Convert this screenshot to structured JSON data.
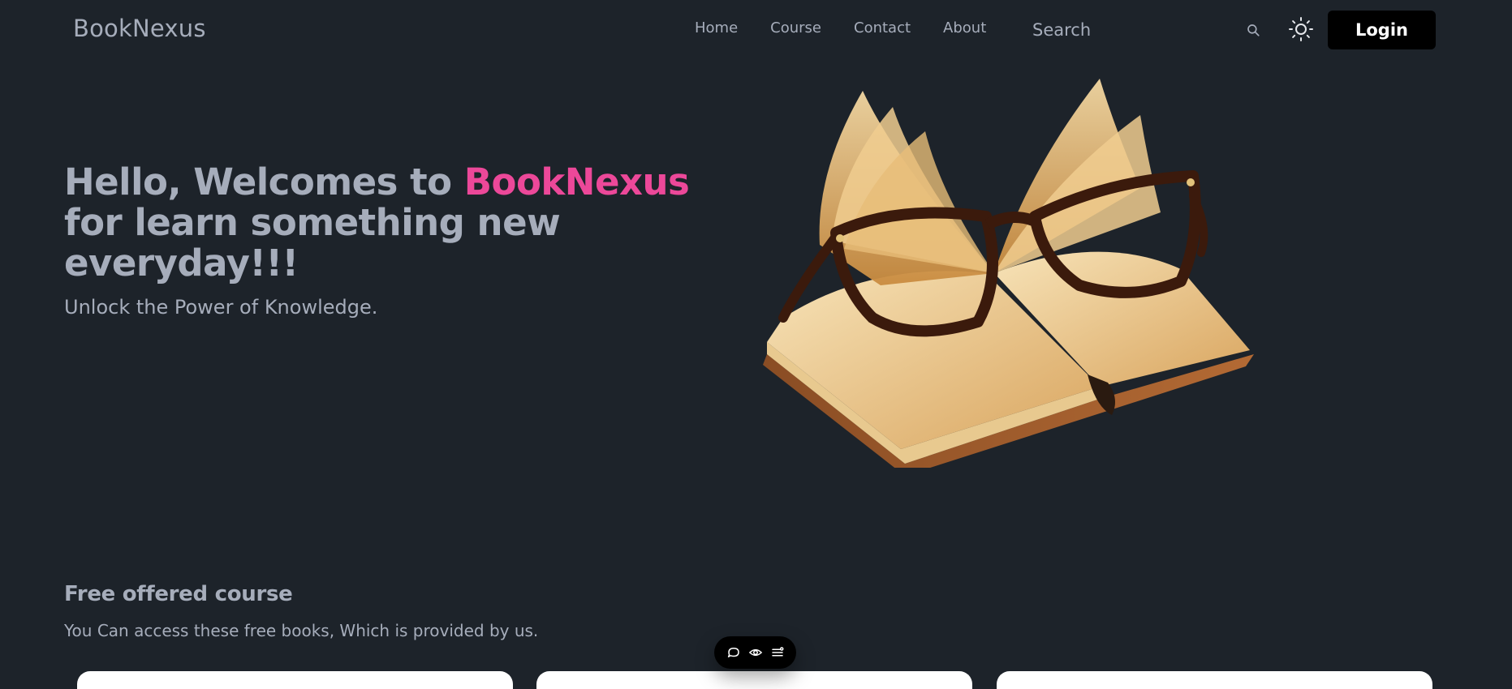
{
  "navbar": {
    "brand": "BookNexus",
    "links": [
      "Home",
      "Course",
      "Contact",
      "About"
    ],
    "search_placeholder": "Search",
    "login_label": "Login",
    "icons": {
      "search": "search-icon",
      "theme": "sun-icon"
    }
  },
  "hero": {
    "title_before": "Hello, Welcomes to ",
    "title_accent": "BookNexus",
    "title_after": " for learn something new everyday!!!",
    "subtitle": "Unlock the Power of Knowledge.",
    "image": "book-with-glasses-illustration"
  },
  "courses": {
    "title": "Free offered course",
    "description": "You Can access these free books, Which is provided by us."
  },
  "toolbar": {
    "icons": [
      "chat-bubble-icon",
      "eye-icon",
      "list-settings-icon"
    ]
  },
  "colors": {
    "background": "#1d232a",
    "text": "#a6adbb",
    "accent": "#ec4899",
    "button": "#000000"
  }
}
